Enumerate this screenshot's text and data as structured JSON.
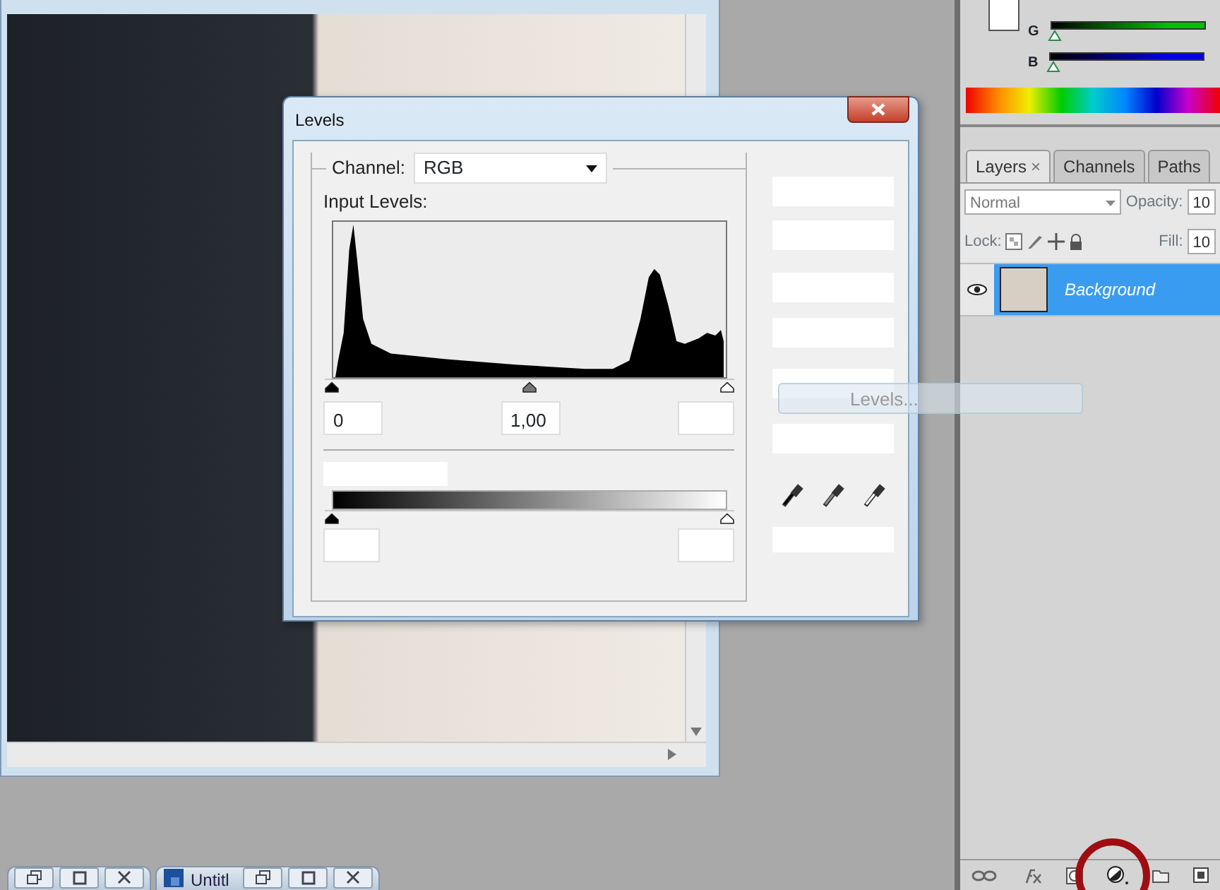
{
  "color_panel": {
    "sliders": [
      {
        "label": "G",
        "level": 0,
        "color": "#00c000"
      },
      {
        "label": "B",
        "level": 0,
        "color": "#0000e0"
      }
    ]
  },
  "layers_panel": {
    "tabs": [
      {
        "label": "Layers",
        "close": "×",
        "selected": true
      },
      {
        "label": "Channels",
        "selected": false
      },
      {
        "label": "Paths",
        "selected": false
      }
    ],
    "blend_mode": "Normal",
    "opacity_label": "Opacity:",
    "opacity_value": "10",
    "lock_label": "Lock:",
    "fill_label": "Fill:",
    "fill_value": "10",
    "layers": [
      {
        "name": "Background",
        "visible": true,
        "selected": true
      }
    ]
  },
  "levels_dialog": {
    "title": "Levels",
    "channel_label": "Channel:",
    "channel": "RGB",
    "input_label": "Input Levels:",
    "input_sliders": [
      {
        "kind": "black",
        "level": 0
      },
      {
        "kind": "gray",
        "level": 0.5
      },
      {
        "kind": "white",
        "level": 1
      }
    ],
    "input_values": [
      "0",
      "1,00"
    ],
    "output_sliders": [
      {
        "kind": "black",
        "level": 0
      },
      {
        "kind": "white",
        "level": 1
      }
    ]
  },
  "drag_preview": {
    "label": "Levels..."
  },
  "minimized_windows": [
    {
      "kind": "plain"
    },
    {
      "kind": "document",
      "title": "Untitl"
    }
  ]
}
